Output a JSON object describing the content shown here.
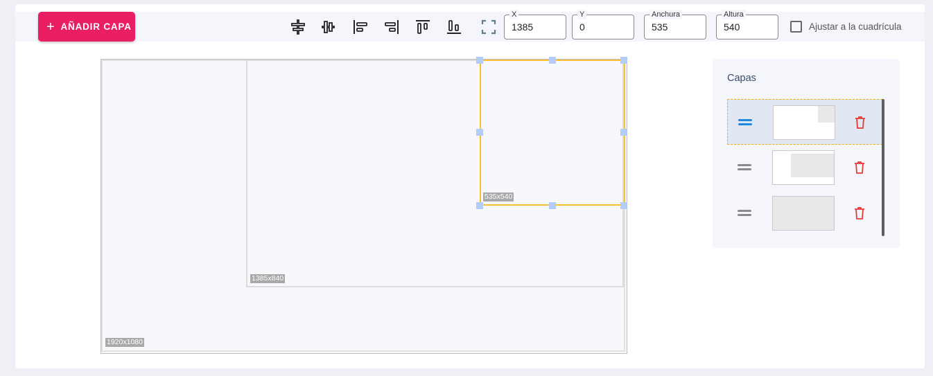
{
  "toolbar": {
    "add_layer_label": "AÑADIR CAPA",
    "add_icon": "plus-icon",
    "align_icons": [
      "align-horizontal-center-icon",
      "align-vertical-center-icon",
      "align-left-icon",
      "align-right-icon",
      "align-top-icon",
      "align-bottom-icon",
      "fullscreen-icon"
    ],
    "fields": {
      "x": {
        "label": "X",
        "value": "1385"
      },
      "y": {
        "label": "Y",
        "value": "0"
      },
      "width": {
        "label": "Anchura",
        "value": "535"
      },
      "height": {
        "label": "Altura",
        "value": "540"
      }
    },
    "snap_to_grid": {
      "label": "Ajustar a la cuadrícula",
      "checked": false
    }
  },
  "canvas": {
    "layers": [
      {
        "size_label": "1920x1080"
      },
      {
        "size_label": "1385x840"
      },
      {
        "size_label": "535x540",
        "selected": true
      }
    ]
  },
  "layers_panel": {
    "title": "Capas",
    "items": [
      {
        "selected": true,
        "drag_icon": "drag-handle-icon",
        "delete_icon": "trash-icon"
      },
      {
        "selected": false,
        "drag_icon": "drag-handle-icon",
        "delete_icon": "trash-icon"
      },
      {
        "selected": false,
        "drag_icon": "drag-handle-icon",
        "delete_icon": "trash-icon"
      }
    ]
  },
  "colors": {
    "accent": "#e91e63",
    "selection": "#fbc02d",
    "handle": "#b3cdf8",
    "delete": "#e53935",
    "drag_active": "#1e88e5"
  }
}
